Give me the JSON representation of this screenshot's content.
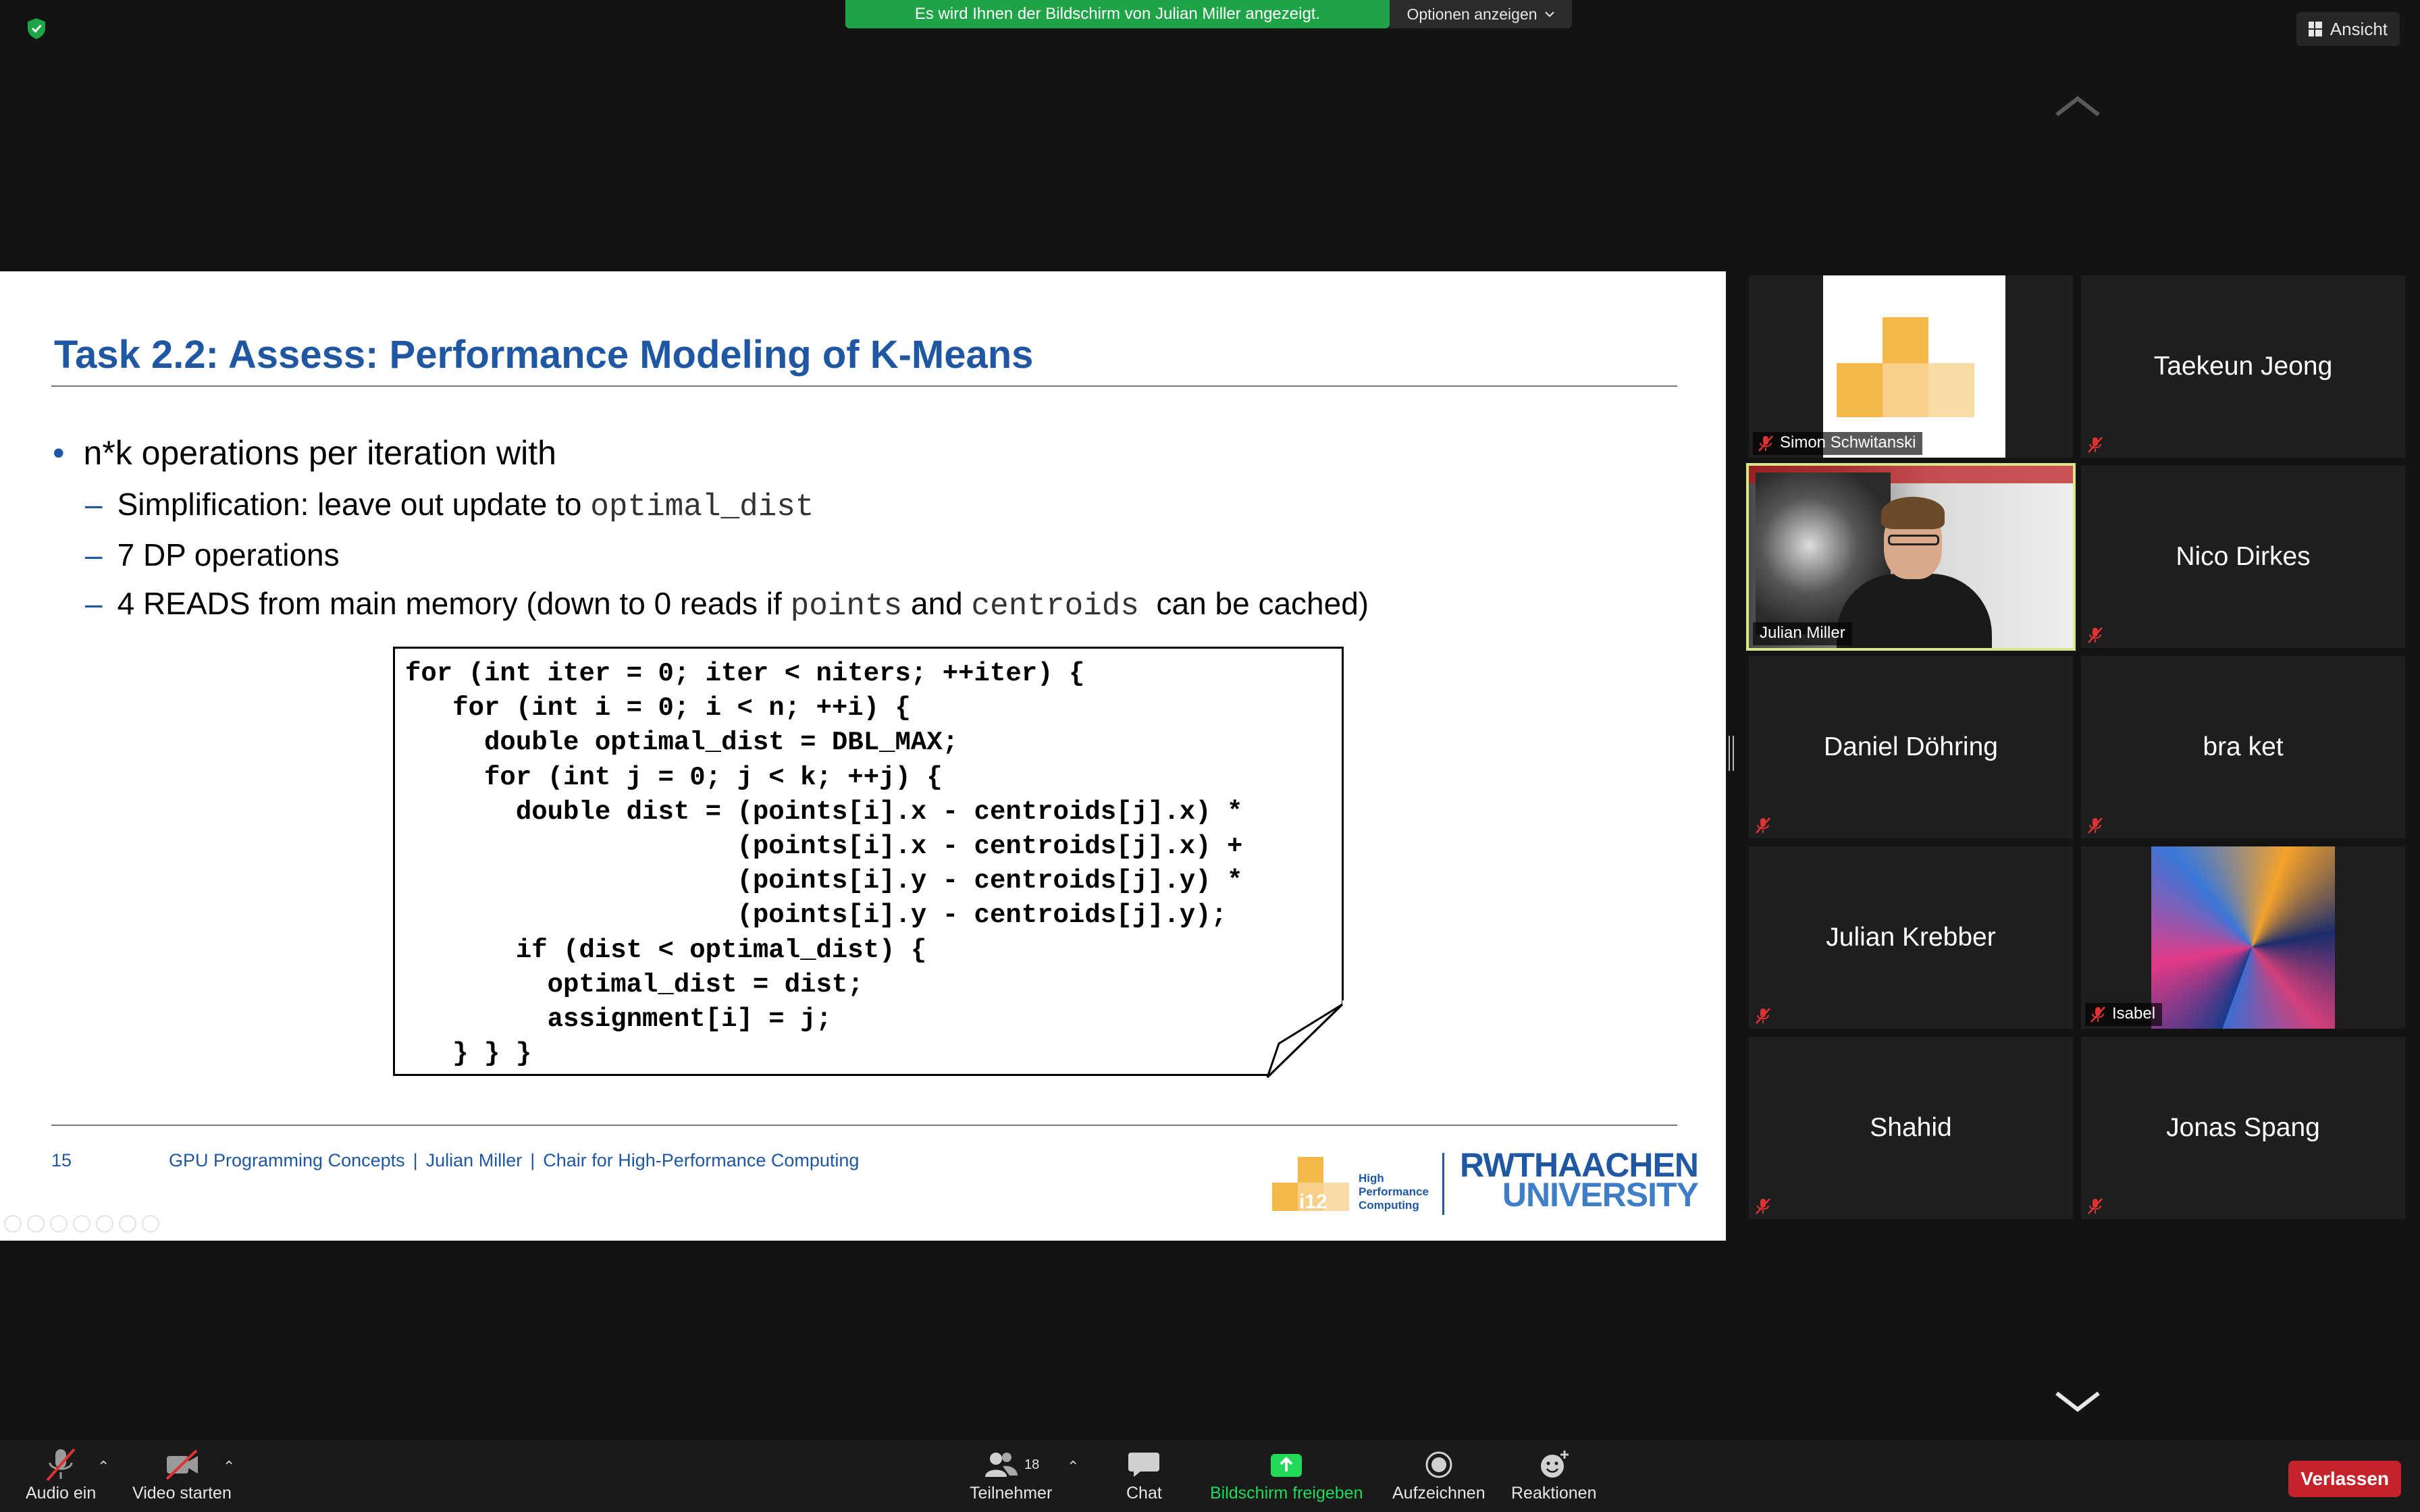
{
  "topbar": {
    "share_banner": "Es wird Ihnen der Bildschirm von Julian Miller angezeigt.",
    "options_label": "Optionen anzeigen",
    "view_label": "Ansicht"
  },
  "slide": {
    "title": "Task 2.2: Assess: Performance Modeling of K-Means",
    "bullet_main": "n*k operations per iteration with",
    "sub1_text": "Simplification: leave out update to ",
    "sub1_code": "optimal_dist",
    "sub2_text": "7 DP operations",
    "sub3_text_a": "4 READS from main memory (down to 0 reads if ",
    "sub3_code_a": "points",
    "sub3_text_b": " and ",
    "sub3_code_b": "centroids",
    "sub3_text_c": "  can be cached)",
    "code": "for (int iter = 0; iter < niters; ++iter) {\n   for (int i = 0; i < n; ++i) {\n     double optimal_dist = DBL_MAX;\n     for (int j = 0; j < k; ++j) {\n       double dist = (points[i].x - centroids[j].x) *\n                     (points[i].x - centroids[j].x) +\n                     (points[i].y - centroids[j].y) *\n                     (points[i].y - centroids[j].y);\n       if (dist < optimal_dist) {\n         optimal_dist = dist;\n         assignment[i] = j;\n   } } }",
    "page_number": "15",
    "footer_course": "GPU Programming Concepts",
    "footer_author": "Julian Miller",
    "footer_chair": "Chair for High-Performance Computing",
    "footer_sep": "|",
    "logo_i12": "i12",
    "logo_text_1": "High",
    "logo_text_2": "Performance",
    "logo_text_3": "Computing",
    "rwth_line1": "RWTHAACHEN",
    "rwth_line2": "UNIVERSITY"
  },
  "participants": [
    {
      "name": "Simon Schwitanski",
      "type": "image-i12",
      "muted": true
    },
    {
      "name": "Taekeun Jeong",
      "type": "name",
      "muted": true
    },
    {
      "name": "Julian Miller",
      "type": "video",
      "muted": false,
      "active": true
    },
    {
      "name": "Nico Dirkes",
      "type": "name",
      "muted": true
    },
    {
      "name": "Daniel Döhring",
      "type": "name",
      "muted": true
    },
    {
      "name": "bra ket",
      "type": "name",
      "muted": true
    },
    {
      "name": "Julian Krebber",
      "type": "name",
      "muted": true
    },
    {
      "name": "Isabel",
      "type": "image-abstract",
      "muted": true
    },
    {
      "name": "Shahid",
      "type": "name",
      "muted": true
    },
    {
      "name": "Jonas Spang",
      "type": "name",
      "muted": true
    }
  ],
  "toolbar": {
    "audio": "Audio ein",
    "video": "Video starten",
    "participants": "Teilnehmer",
    "participants_count": "18",
    "chat": "Chat",
    "share": "Bildschirm freigeben",
    "record": "Aufzeichnen",
    "reactions": "Reaktionen",
    "leave": "Verlassen"
  },
  "colors": {
    "banner_green": "#1ea446",
    "slide_blue": "#1f57a3",
    "active_speaker_border": "#d8e889",
    "leave_red": "#c4232b",
    "share_green": "#23d959"
  }
}
